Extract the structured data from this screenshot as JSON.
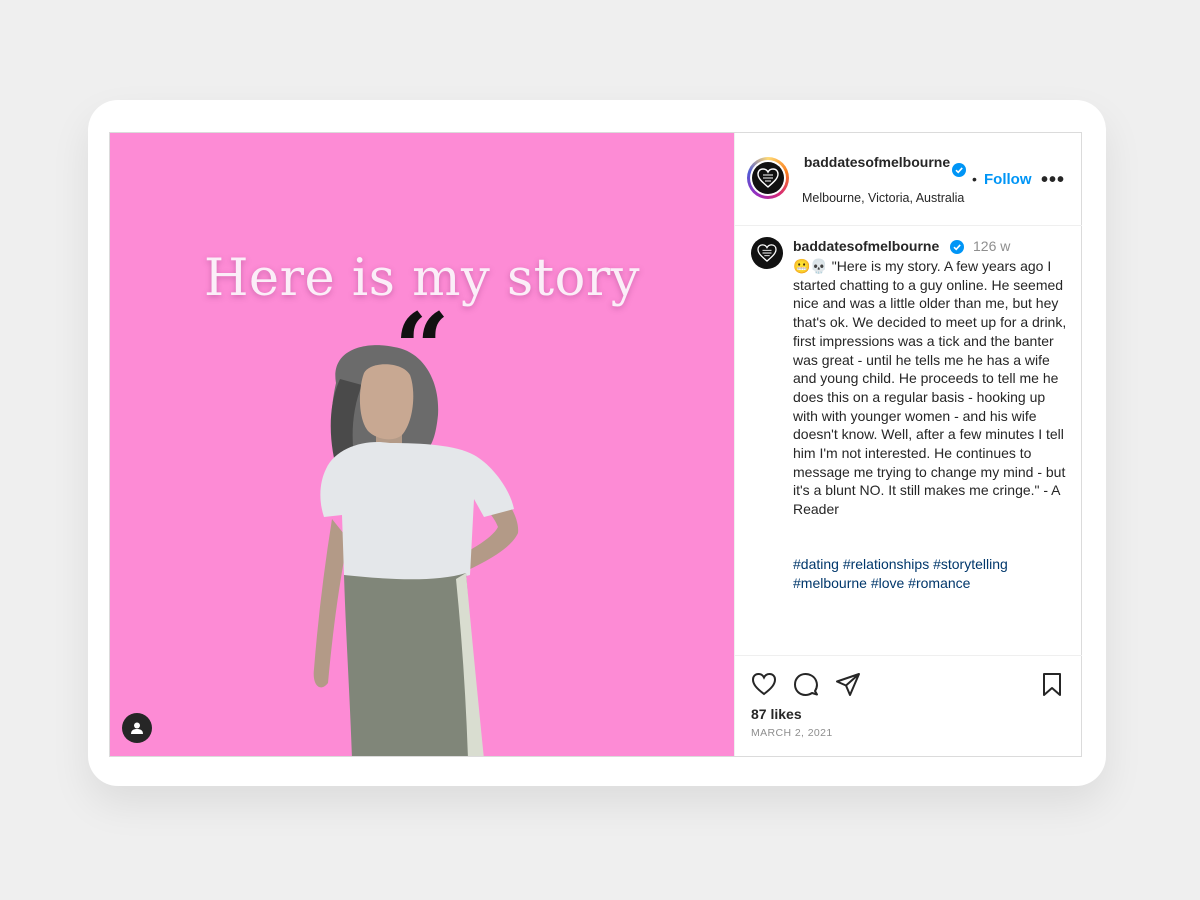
{
  "media": {
    "quote_mark": "“",
    "title": "Here is my story",
    "background_color": "#fd8bd5"
  },
  "header": {
    "username": "baddatesofmelbourne",
    "verified": true,
    "separator": "•",
    "follow_label": "Follow",
    "more_label": "•••",
    "location": "Melbourne, Victoria, Australia"
  },
  "caption": {
    "username": "baddatesofmelbourne",
    "time": "126 w",
    "text": "😬💀 \"Here is my story. A few years ago I started chatting to a guy online. He seemed nice and was a little older than me, but hey that's ok. We decided to meet up for a drink, first impressions was a tick and the banter was great - until he tells me he has a wife and young child. He proceeds to tell me he does this on a regular basis - hooking up with with younger women - and his wife doesn't know. Well, after a few minutes I tell him I'm not interested. He continues to message me trying to change my mind - but it's a blunt NO. It still makes me cringe.\" - A Reader",
    "hashtags": "#dating #relationships #storytelling #melbourne #love #romance"
  },
  "engagement": {
    "likes": "87 likes",
    "date": "MARCH 2, 2021"
  },
  "icons": {
    "like": "heart-icon",
    "comment": "comment-icon",
    "share": "send-icon",
    "save": "bookmark-icon",
    "tag": "user-tag-icon",
    "verified": "verified-badge-icon"
  },
  "colors": {
    "accent": "#0095f6",
    "hashtag": "#00376b",
    "muted": "#8e8e8e"
  }
}
